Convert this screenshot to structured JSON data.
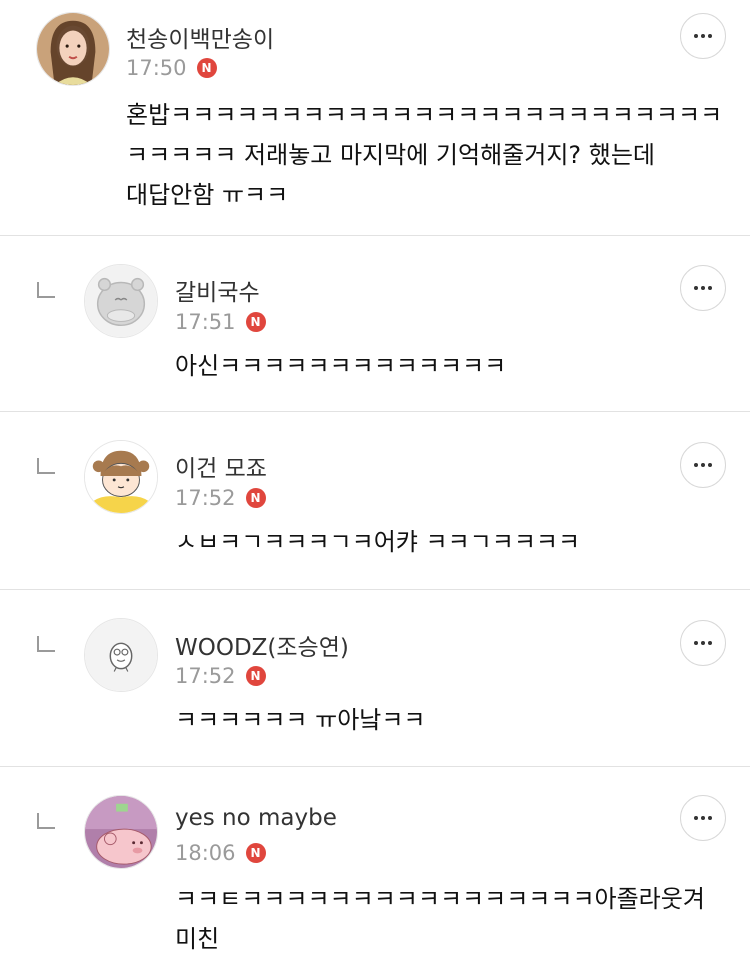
{
  "comments": [
    {
      "author": "천송이백만송이",
      "time": "17:50",
      "badge": "N",
      "text": "혼밥ㅋㅋㅋㅋㅋㅋㅋㅋㅋㅋㅋㅋㅋㅋㅋㅋㅋㅋㅋㅋㅋㅋㅋㅋㅋ\nㅋㅋㅋㅋㅋ 저래놓고 마지막에 기억해줄거지? 했는데\n대답안함 ㅠㅋㅋ",
      "is_reply": false
    },
    {
      "author": "갈비국수",
      "time": "17:51",
      "badge": "N",
      "text": "아신ㅋㅋㅋㅋㅋㅋㅋㅋㅋㅋㅋㅋㅋ",
      "is_reply": true
    },
    {
      "author": "이건 모죠",
      "time": "17:52",
      "badge": "N",
      "text": "ㅅㅂㅋㄱㅋㅋㅋㄱㅋ어캬 ㅋㅋㄱㅋㅋㅋㅋ",
      "is_reply": true
    },
    {
      "author": "WOODZ(조승연)",
      "time": "17:52",
      "badge": "N",
      "text": "ㅋㅋㅋㅋㅋㅋ ㅠ아낰ㅋㅋ",
      "is_reply": true
    },
    {
      "author": "yes no maybe",
      "time": "18:06",
      "badge": "N",
      "text": "ㅋㅋㅌㅋㅋㅋㅋㅋㅋㅋㅋㅋㅋㅋㅋㅋㅋㅋㅋ아졸라웃겨\n미친",
      "is_reply": true
    }
  ],
  "colors": {
    "badge": "#e0463d",
    "divider": "#e2e2e2",
    "meta": "#9a9a9a"
  },
  "icons": {
    "more": "more-options-icon",
    "reply": "reply-arrow-icon",
    "new": "new-badge-icon"
  }
}
